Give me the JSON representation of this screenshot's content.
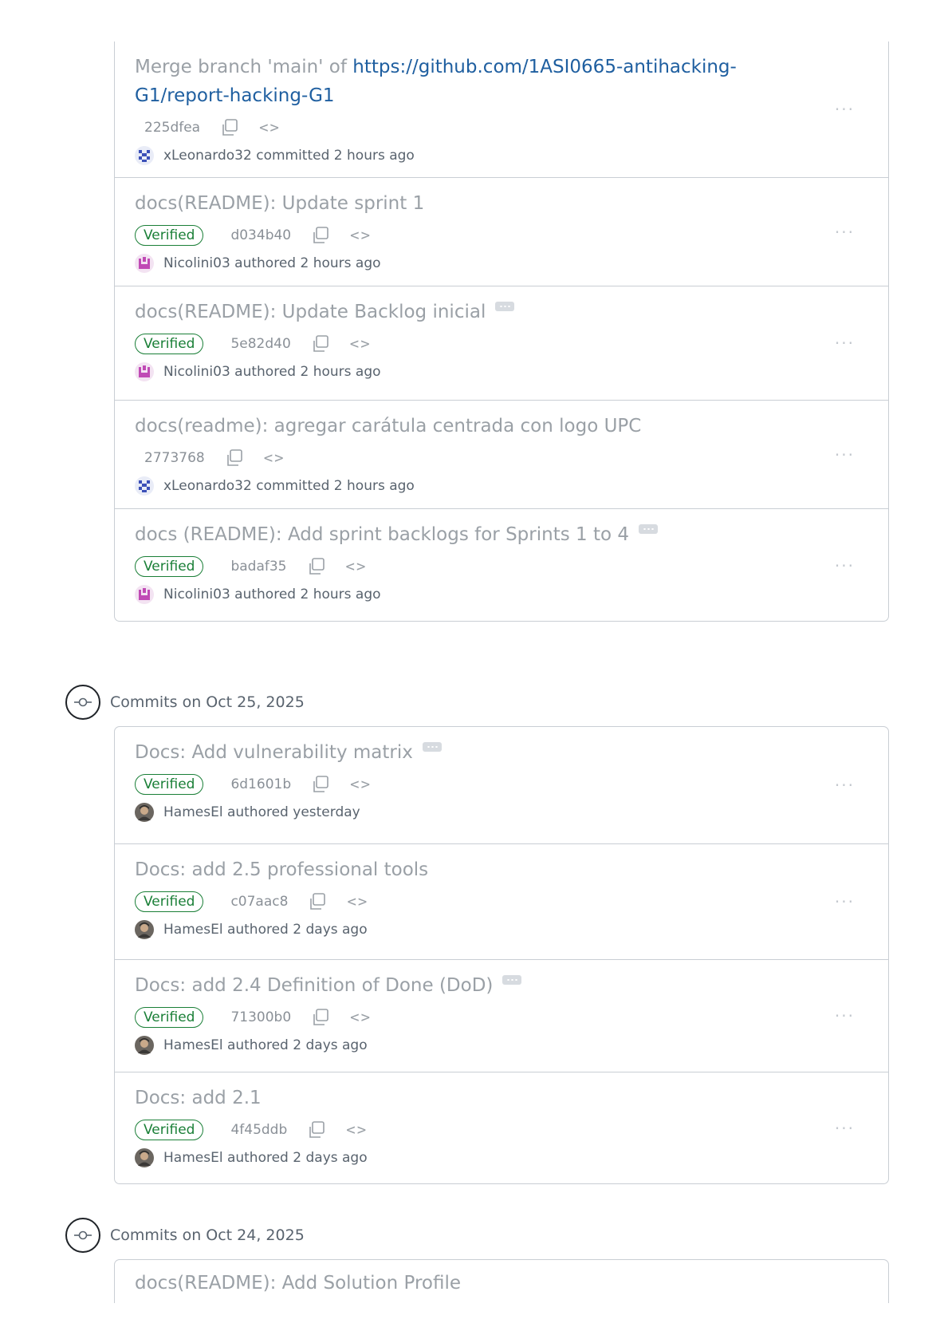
{
  "groups": [
    {
      "header": "",
      "commits": [
        {
          "title_prefix": "Merge branch 'main' of ",
          "title_link": "https://github.com/1ASI0665-antihacking-G1/report-hacking-G1",
          "verified": false,
          "sha": "225dfea",
          "author": "xLeonardo32",
          "action": "committed",
          "time": "2 hours ago"
        },
        {
          "title": "docs(README): Update sprint 1",
          "verified": true,
          "sha": "d034b40",
          "author": "Nicolini03",
          "action": "authored",
          "time": "2 hours ago"
        },
        {
          "title": "docs(README): Update Backlog inicial",
          "expand": true,
          "verified": true,
          "sha": "5e82d40",
          "author": "Nicolini03",
          "action": "authored",
          "time": "2 hours ago"
        },
        {
          "title": "docs(readme): agregar carátula centrada con logo UPC",
          "verified": false,
          "sha": "2773768",
          "author": "xLeonardo32",
          "action": "committed",
          "time": "2 hours ago"
        },
        {
          "title": "docs (README): Add sprint backlogs for Sprints 1 to 4",
          "expand": true,
          "verified": true,
          "sha": "badaf35",
          "author": "Nicolini03",
          "action": "authored",
          "time": "2 hours ago"
        }
      ]
    },
    {
      "header": "Commits on Oct 25, 2025",
      "commits": [
        {
          "title": "Docs: Add vulnerability matrix",
          "expand": true,
          "verified": true,
          "sha": "6d1601b",
          "author": "HamesEl",
          "action": "authored",
          "time": "yesterday"
        },
        {
          "title": "Docs: add 2.5 professional tools",
          "verified": true,
          "sha": "c07aac8",
          "author": "HamesEl",
          "action": "authored",
          "time": "2 days ago"
        },
        {
          "title": "Docs: add 2.4 Definition of Done (DoD)",
          "expand": true,
          "verified": true,
          "sha": "71300b0",
          "author": "HamesEl",
          "action": "authored",
          "time": "2 days ago"
        },
        {
          "title": "Docs: add 2.1",
          "verified": true,
          "sha": "4f45ddb",
          "author": "HamesEl",
          "action": "authored",
          "time": "2 days ago"
        }
      ]
    },
    {
      "header": "Commits on Oct 24, 2025",
      "commits": [
        {
          "title": "docs(README): Add Solution Profile"
        }
      ]
    }
  ],
  "labels": {
    "verified": "Verified",
    "kebab": "···",
    "code": "<>"
  },
  "colors": {
    "verified": "#1a7f37",
    "link": "#1f5fa0",
    "title_muted": "#9aa0a6",
    "border": "#c9ced4"
  },
  "icons": {
    "copy": "copy-icon",
    "code": "code-icon",
    "kebab": "kebab-horizontal-icon",
    "node": "git-commit-icon",
    "expand": "ellipsis-icon"
  }
}
